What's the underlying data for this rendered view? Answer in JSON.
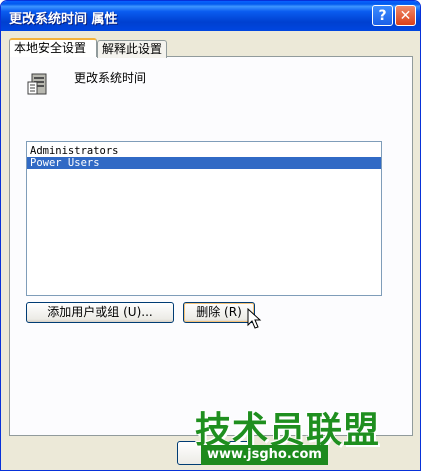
{
  "window": {
    "title": "更改系统时间 属性",
    "help_label": "?",
    "close_label": "✕"
  },
  "tabs": [
    {
      "label": "本地安全设置",
      "active": true
    },
    {
      "label": "解释此设置",
      "active": false
    }
  ],
  "policy": {
    "name": "更改系统时间",
    "icon": "policy-server-icon"
  },
  "members": [
    {
      "name": "Administrators",
      "selected": false
    },
    {
      "name": "Power Users",
      "selected": true
    }
  ],
  "buttons": {
    "add_label": "添加用户或组 (U)...",
    "remove_label": "删除 (R)"
  },
  "watermark": {
    "title": "技术员联盟",
    "url": "www.jsgho.com"
  },
  "colors": {
    "titlebar": "#0054e3",
    "selection": "#316ac5",
    "watermark": "#1f8f1f"
  }
}
